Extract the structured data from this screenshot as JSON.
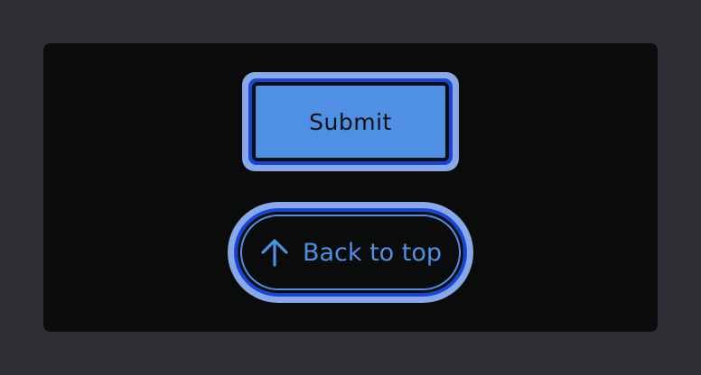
{
  "buttons": {
    "submit_label": "Submit",
    "back_to_top_label": "Back to top",
    "back_to_top_icon": "arrow-up-icon"
  },
  "colors": {
    "page_background": "#2d2f34",
    "panel_background": "#0a0b0b",
    "accent": "#4f8fe4",
    "focus_ring_outer": "#89a8e8",
    "focus_ring_inner": "#1546d4"
  }
}
